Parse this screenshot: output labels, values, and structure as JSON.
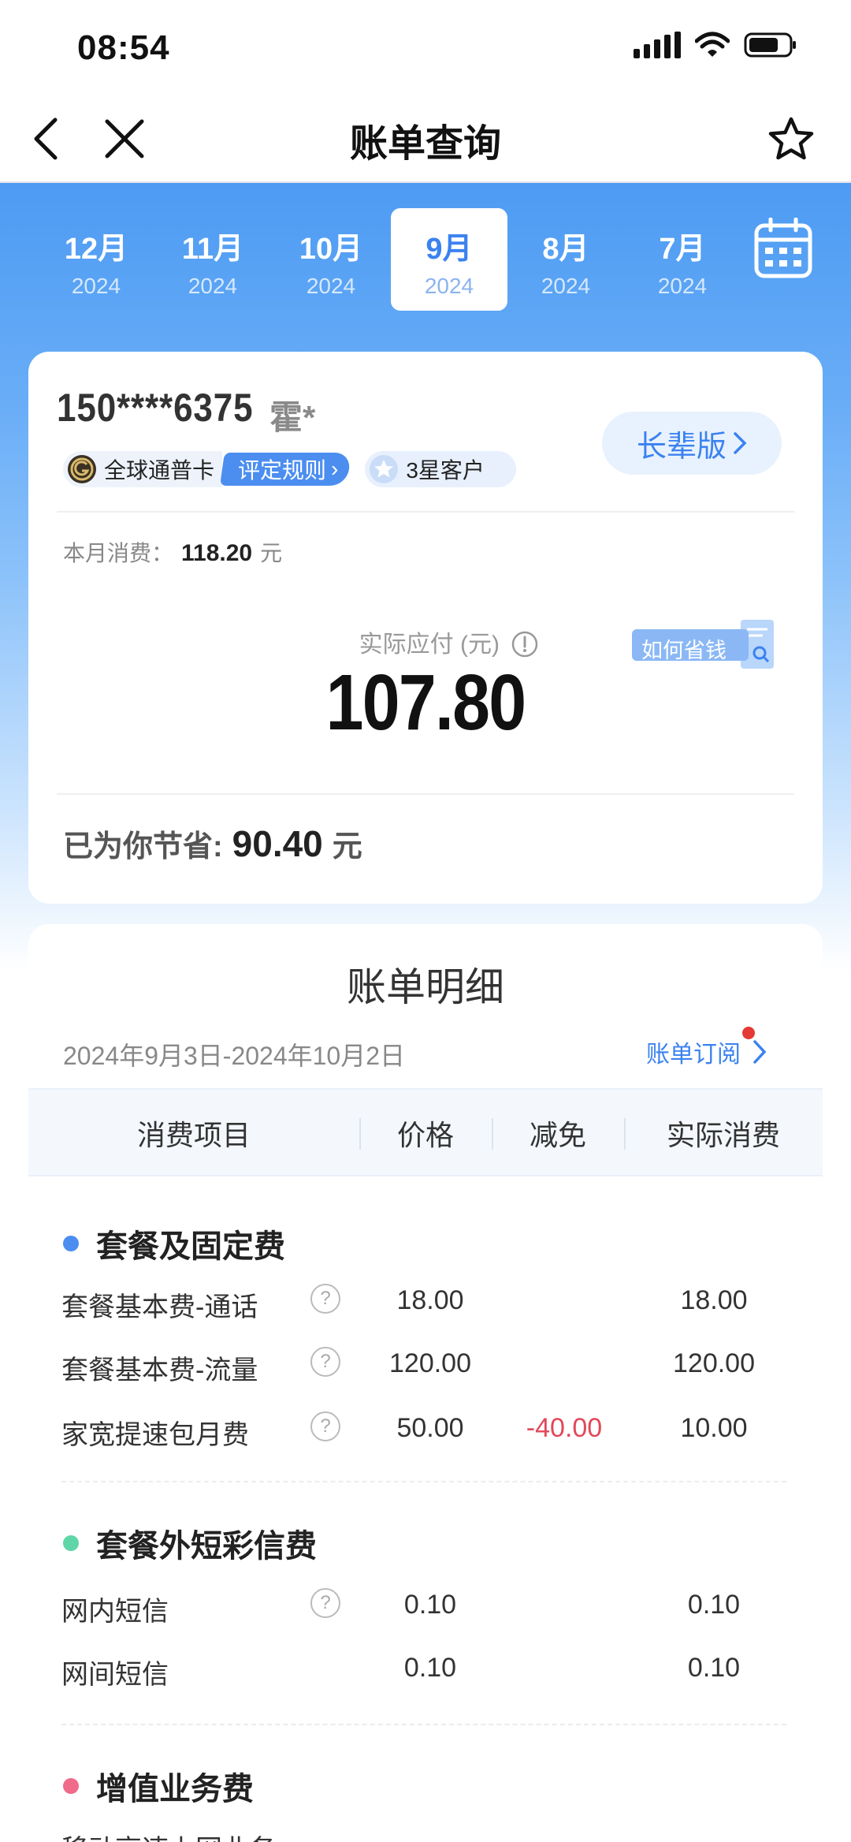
{
  "status_bar": {
    "time": "08:54"
  },
  "nav": {
    "title": "账单查询"
  },
  "months": [
    {
      "month": "12月",
      "year": "2024"
    },
    {
      "month": "11月",
      "year": "2024"
    },
    {
      "month": "10月",
      "year": "2024"
    },
    {
      "month": "9月",
      "year": "2024",
      "active": true
    },
    {
      "month": "8月",
      "year": "2024"
    },
    {
      "month": "7月",
      "year": "2024"
    }
  ],
  "account": {
    "phone": "150****6375",
    "name": "霍*",
    "elder_label": "长辈版",
    "card_badge": "全球通普卡",
    "rule_label": "评定规则",
    "star_badge": "3星客户",
    "monthly_label": "本月消费：",
    "monthly_amount": "118.20",
    "monthly_unit": "元",
    "due_label": "实际应付 (元)",
    "due_amount": "107.80",
    "save_tip": "如何省钱",
    "saved_label": "已为你节省:",
    "saved_amount": "90.40",
    "saved_unit": "元"
  },
  "detail": {
    "title": "账单明细",
    "period": "2024年9月3日-2024年10月2日",
    "subscribe_label": "账单订阅",
    "columns": [
      "消费项目",
      "价格",
      "减免",
      "实际消费"
    ],
    "sections": [
      {
        "title": "套餐及固定费",
        "dot_color": "#4b8ef0",
        "rows": [
          {
            "label": "套餐基本费-通话",
            "help": true,
            "price": "18.00",
            "discount": "",
            "actual": "18.00"
          },
          {
            "label": "套餐基本费-流量",
            "help": true,
            "price": "120.00",
            "discount": "",
            "actual": "120.00"
          },
          {
            "label": "家宽提速包月费",
            "help": true,
            "price": "50.00",
            "discount": "-40.00",
            "actual": "10.00"
          }
        ]
      },
      {
        "title": "套餐外短彩信费",
        "dot_color": "#5fd6a7",
        "rows": [
          {
            "label": "网内短信",
            "help": true,
            "price": "0.10",
            "discount": "",
            "actual": "0.10"
          },
          {
            "label": "网间短信",
            "help": false,
            "price": "0.10",
            "discount": "",
            "actual": "0.10"
          }
        ]
      },
      {
        "title": "增值业务费",
        "dot_color": "#f06a8a",
        "rows": []
      }
    ],
    "cut_off_text": "移动高速上网业务"
  },
  "icons": {
    "back": "back-arrow-icon",
    "close": "close-icon",
    "favorite": "star-outline-icon",
    "calendar": "calendar-icon"
  }
}
